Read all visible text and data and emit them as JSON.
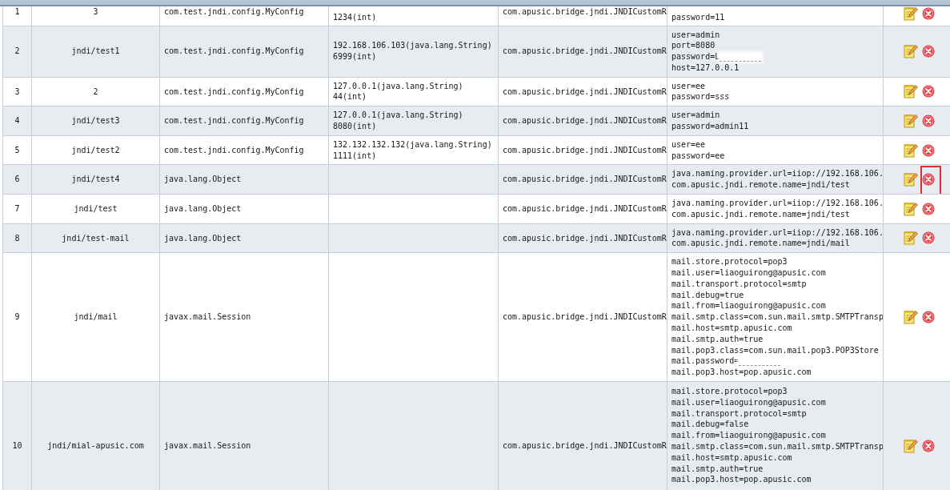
{
  "table": {
    "rows": [
      {
        "column_1": "1",
        "column_2": "3",
        "column_3": "com.test.jndi.config.MyConfig",
        "column_4": [
          "1234(int)"
        ],
        "column_5": "com.apusic.bridge.jndi.JNDICustomR",
        "column_6": [
          {
            "text": "password=11",
            "redacted": false
          }
        ],
        "x_icon_highlighted": false
      },
      {
        "column_1": "2",
        "column_2": "jndi/test1",
        "column_3": "com.test.jndi.config.MyConfig",
        "column_4": [
          "192.168.106.103(java.lang.String)",
          "6999(int)"
        ],
        "column_5": "com.apusic.bridge.jndi.JNDICustomR",
        "column_6": [
          {
            "text": "user=admin",
            "redacted": false
          },
          {
            "text": "port=8080",
            "redacted": false
          },
          {
            "text": "password=L",
            "redacted": true
          },
          {
            "text": "host=127.0.0.1",
            "redacted": false
          }
        ],
        "x_icon_highlighted": false
      },
      {
        "column_1": "3",
        "column_2": "2",
        "column_3": "com.test.jndi.config.MyConfig",
        "column_4": [
          "127.0.0.1(java.lang.String)",
          "44(int)"
        ],
        "column_5": "com.apusic.bridge.jndi.JNDICustomR",
        "column_6": [
          {
            "text": "user=ee",
            "redacted": false
          },
          {
            "text": "password=sss",
            "redacted": false
          }
        ],
        "x_icon_highlighted": false
      },
      {
        "column_1": "4",
        "column_2": "jndi/test3",
        "column_3": "com.test.jndi.config.MyConfig",
        "column_4": [
          "127.0.0.1(java.lang.String)",
          "8080(int)"
        ],
        "column_5": "com.apusic.bridge.jndi.JNDICustomR",
        "column_6": [
          {
            "text": "user=admin",
            "redacted": false
          },
          {
            "text": "password=admin11",
            "redacted": false
          }
        ],
        "x_icon_highlighted": false
      },
      {
        "column_1": "5",
        "column_2": "jndi/test2",
        "column_3": "com.test.jndi.config.MyConfig",
        "column_4": [
          "132.132.132.132(java.lang.String)",
          "1111(int)"
        ],
        "column_5": "com.apusic.bridge.jndi.JNDICustomR",
        "column_6": [
          {
            "text": "user=ee",
            "redacted": false
          },
          {
            "text": "password=ee",
            "redacted": false
          }
        ],
        "x_icon_highlighted": false
      },
      {
        "column_1": "6",
        "column_2": "jndi/test4",
        "column_3": "java.lang.Object",
        "column_5": "com.apusic.bridge.jndi.JNDICustomR",
        "column_6": [
          {
            "text": "java.naming.provider.url=iiop://192.168.106.",
            "redacted": false
          },
          {
            "text": "com.apusic.jndi.remote.name=jndi/test",
            "redacted": false
          }
        ],
        "x_icon_highlighted": true
      },
      {
        "column_1": "7",
        "column_2": "jndi/test",
        "column_3": "java.lang.Object",
        "column_5": "com.apusic.bridge.jndi.JNDICustomR",
        "column_6": [
          {
            "text": "java.naming.provider.url=iiop://192.168.106.",
            "redacted": false
          },
          {
            "text": "com.apusic.jndi.remote.name=jndi/test",
            "redacted": false
          }
        ],
        "x_icon_highlighted": false
      },
      {
        "column_1": "8",
        "column_2": "jndi/test-mail",
        "column_3": "java.lang.Object",
        "column_5": "com.apusic.bridge.jndi.JNDICustomR",
        "column_6": [
          {
            "text": "java.naming.provider.url=iiop://192.168.106.",
            "redacted": false
          },
          {
            "text": "com.apusic.jndi.remote.name=jndi/mail",
            "redacted": false
          }
        ],
        "x_icon_highlighted": false
      },
      {
        "column_1": "9",
        "column_2": "jndi/mail",
        "column_3": "javax.mail.Session",
        "column_5": "com.apusic.bridge.jndi.JNDICustomR",
        "column_6": [
          {
            "text": "mail.store.protocol=pop3",
            "redacted": false
          },
          {
            "text": "mail.user=liaoguirong@apusic.com",
            "redacted": false
          },
          {
            "text": "mail.transport.protocol=smtp",
            "redacted": false
          },
          {
            "text": "mail.debug=true",
            "redacted": false
          },
          {
            "text": "mail.from=liaoguirong@apusic.com",
            "redacted": false
          },
          {
            "text": "mail.smtp.class=com.sun.mail.smtp.SMTPTransp",
            "redacted": false
          },
          {
            "text": "mail.host=smtp.apusic.com",
            "redacted": false
          },
          {
            "text": "mail.smtp.auth=true",
            "redacted": false
          },
          {
            "text": "mail.pop3.class=com.sun.mail.pop3.POP3Store",
            "redacted": false
          },
          {
            "text": "mail.password=",
            "redacted": true
          },
          {
            "text": "mail.pop3.host=pop.apusic.com",
            "redacted": false
          }
        ],
        "x_icon_highlighted": false
      },
      {
        "column_1": "10",
        "column_2": "jndi/mial-apusic.com",
        "column_3": "javax.mail.Session",
        "column_5": "com.apusic.bridge.jndi.JNDICustomR",
        "column_6": [
          {
            "text": "mail.store.protocol=pop3",
            "redacted": false
          },
          {
            "text": "mail.user=liaoguirong@apusic.com",
            "redacted": false
          },
          {
            "text": "mail.transport.protocol=smtp",
            "redacted": false
          },
          {
            "text": "mail.debug=false",
            "redacted": false
          },
          {
            "text": "mail.from=liaoguirong@apusic.com",
            "redacted": false
          },
          {
            "text": "mail.smtp.class=com.sun.mail.smtp.SMTPTransp",
            "redacted": false
          },
          {
            "text": "mail.host=smtp.apusic.com",
            "redacted": false
          },
          {
            "text": "mail.smtp.auth=true",
            "redacted": false
          },
          {
            "text": "mail.pop3.host=pop.apusic.com",
            "redacted": false
          }
        ],
        "x_icon_highlighted": false
      }
    ]
  }
}
